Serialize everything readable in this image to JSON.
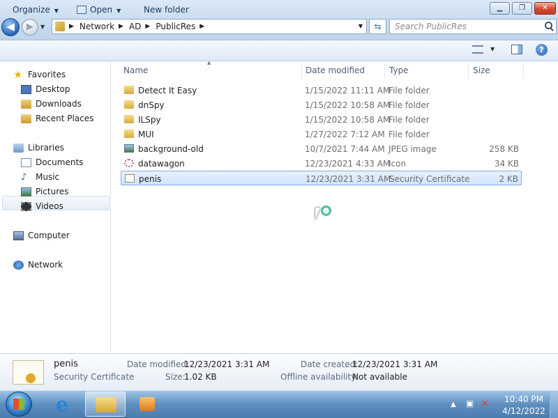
{
  "window": {
    "min_label": "▁",
    "max_label": "❐",
    "close_label": "✕"
  },
  "address": {
    "crumbs": [
      "Network",
      "AD",
      "PublicRes"
    ],
    "search_placeholder": "Search PublicRes"
  },
  "toolbar": {
    "organize": "Organize",
    "open": "Open",
    "new_folder": "New folder",
    "help": "?"
  },
  "nav": {
    "favorites": "Favorites",
    "desktop": "Desktop",
    "downloads": "Downloads",
    "recent_places": "Recent Places",
    "libraries": "Libraries",
    "documents": "Documents",
    "music": "Music",
    "pictures": "Pictures",
    "videos": "Videos",
    "computer": "Computer",
    "network": "Network"
  },
  "columns": {
    "name": "Name",
    "date": "Date modified",
    "type": "Type",
    "size": "Size"
  },
  "files": [
    {
      "name": "Detect It Easy",
      "date": "1/15/2022 11:11 AM",
      "type": "File folder",
      "size": "",
      "icon": "folder-icon"
    },
    {
      "name": "dnSpy",
      "date": "1/15/2022 10:58 AM",
      "type": "File folder",
      "size": "",
      "icon": "folder-icon"
    },
    {
      "name": "ILSpy",
      "date": "1/15/2022 10:58 AM",
      "type": "File folder",
      "size": "",
      "icon": "folder-icon"
    },
    {
      "name": "MUI",
      "date": "1/27/2022 7:12 AM",
      "type": "File folder",
      "size": "",
      "icon": "folder-icon"
    },
    {
      "name": "background-old",
      "date": "10/7/2021 7:44 AM",
      "type": "JPEG image",
      "size": "258 KB",
      "icon": "image-icon"
    },
    {
      "name": "datawagon",
      "date": "12/23/2021 4:33 AM",
      "type": "Icon",
      "size": "34 KB",
      "icon": "icon-file-icon"
    },
    {
      "name": "penis",
      "date": "12/23/2021 3:31 AM",
      "type": "Security Certificate",
      "size": "2 KB",
      "icon": "certificate-icon"
    }
  ],
  "selected_index": 6,
  "details": {
    "name": "penis",
    "type": "Security Certificate",
    "date_modified_label": "Date modified:",
    "date_modified": "12/23/2021 3:31 AM",
    "size_label": "Size:",
    "size": "1.02 KB",
    "date_created_label": "Date created:",
    "date_created": "12/23/2021 3:31 AM",
    "offline_label": "Offline availability:",
    "offline": "Not available"
  },
  "taskbar": {
    "time": "10:40 PM",
    "date": "4/12/2022",
    "tray_arrow": "▲"
  },
  "colors": {
    "selection": "#cfe4fb",
    "taskbar": "#5e8fbf"
  }
}
